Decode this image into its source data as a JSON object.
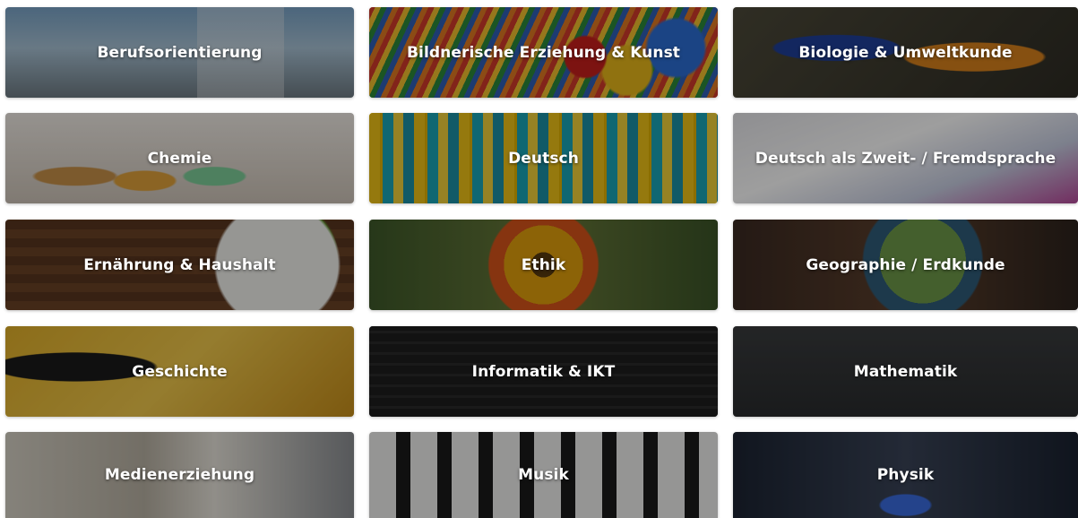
{
  "tiles": [
    {
      "label": "Berufsorientierung"
    },
    {
      "label": "Bildnerische Erziehung & Kunst"
    },
    {
      "label": "Biologie & Umweltkunde"
    },
    {
      "label": "Chemie"
    },
    {
      "label": "Deutsch"
    },
    {
      "label": "Deutsch als Zweit- / Fremdsprache"
    },
    {
      "label": "Ernährung & Haushalt"
    },
    {
      "label": "Ethik"
    },
    {
      "label": "Geographie / Erdkunde"
    },
    {
      "label": "Geschichte"
    },
    {
      "label": "Informatik & IKT"
    },
    {
      "label": "Mathematik"
    },
    {
      "label": "Medienerziehung"
    },
    {
      "label": "Musik"
    },
    {
      "label": "Physik"
    }
  ],
  "colors": {
    "label_text": "#ffffff",
    "overlay": "#000000"
  }
}
